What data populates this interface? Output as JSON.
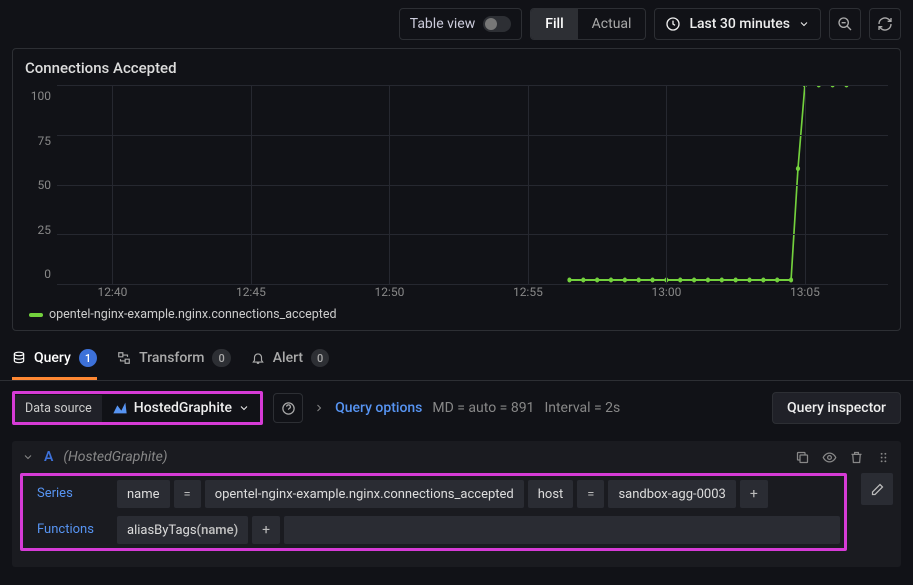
{
  "toolbar": {
    "table_view_label": "Table view",
    "fill_label": "Fill",
    "actual_label": "Actual",
    "time_range": "Last 30 minutes"
  },
  "panel": {
    "title": "Connections Accepted",
    "legend": "opentel-nginx-example.nginx.connections_accepted"
  },
  "chart_data": {
    "type": "line",
    "ylim": [
      0,
      100
    ],
    "y_ticks": [
      100,
      75,
      50,
      25,
      0
    ],
    "x_ticks": [
      "12:40",
      "12:45",
      "12:50",
      "12:55",
      "13:00",
      "13:05"
    ],
    "series": [
      {
        "name": "opentel-nginx-example.nginx.connections_accepted",
        "color": "#73d13d",
        "points": [
          {
            "t": "12:56:30",
            "v": 2
          },
          {
            "t": "12:57:00",
            "v": 2
          },
          {
            "t": "12:57:30",
            "v": 2
          },
          {
            "t": "12:58:00",
            "v": 2
          },
          {
            "t": "12:58:30",
            "v": 2
          },
          {
            "t": "12:59:00",
            "v": 2
          },
          {
            "t": "12:59:30",
            "v": 2
          },
          {
            "t": "13:00:00",
            "v": 2
          },
          {
            "t": "13:00:30",
            "v": 2
          },
          {
            "t": "13:01:00",
            "v": 2
          },
          {
            "t": "13:01:30",
            "v": 2
          },
          {
            "t": "13:02:00",
            "v": 2
          },
          {
            "t": "13:02:30",
            "v": 2
          },
          {
            "t": "13:03:00",
            "v": 2
          },
          {
            "t": "13:03:30",
            "v": 2
          },
          {
            "t": "13:04:00",
            "v": 2
          },
          {
            "t": "13:04:30",
            "v": 2
          },
          {
            "t": "13:04:45",
            "v": 58
          },
          {
            "t": "13:05:00",
            "v": 100
          },
          {
            "t": "13:05:30",
            "v": 100
          },
          {
            "t": "13:06:00",
            "v": 100
          },
          {
            "t": "13:06:30",
            "v": 100
          }
        ]
      }
    ]
  },
  "tabs": {
    "query": {
      "label": "Query",
      "count": "1"
    },
    "transform": {
      "label": "Transform",
      "count": "0"
    },
    "alert": {
      "label": "Alert",
      "count": "0"
    }
  },
  "ds": {
    "label": "Data source",
    "value": "HostedGraphite",
    "query_options": "Query options",
    "md_auto": "MD = auto = 891",
    "interval": "Interval = 2s",
    "inspector": "Query inspector"
  },
  "query": {
    "ref": "A",
    "source": "(HostedGraphite)",
    "series_label": "Series",
    "name_key": "name",
    "eq": "=",
    "name_val": "opentel-nginx-example.nginx.connections_accepted",
    "host_key": "host",
    "host_val": "sandbox-agg-0003",
    "plus": "+",
    "functions_label": "Functions",
    "fn_name": "aliasByTags",
    "fn_args": "(name)"
  }
}
